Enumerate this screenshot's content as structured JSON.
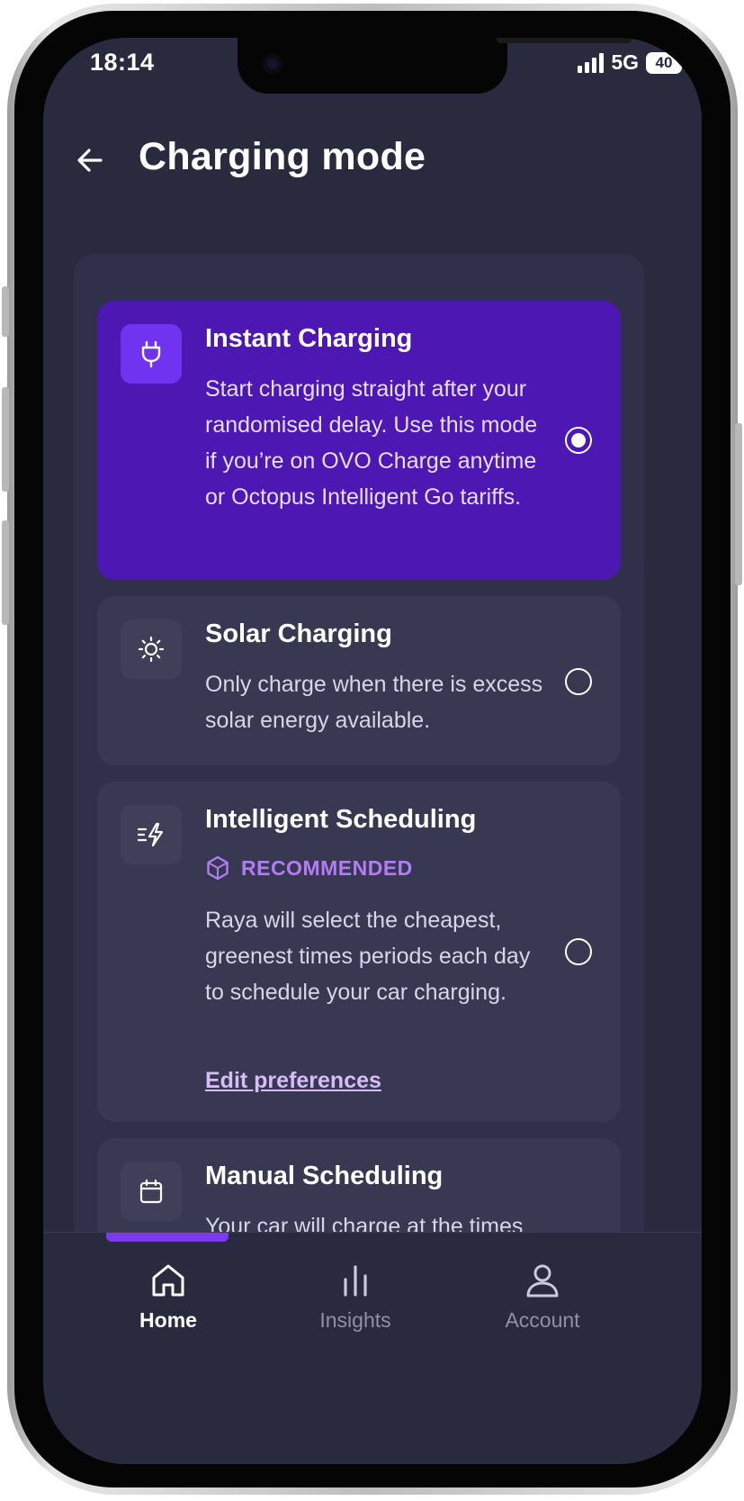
{
  "status_bar": {
    "time": "18:14",
    "network": "5G",
    "battery": "40"
  },
  "header": {
    "title": "Charging mode",
    "back_icon": "arrow-left-icon"
  },
  "modes": [
    {
      "title": "Instant Charging",
      "description": "Start charging straight after your randomised delay. Use this mode if you’re on OVO Charge anytime or Octopus Intelligent Go tariffs.",
      "icon": "plug-icon",
      "selected": true
    },
    {
      "title": "Solar Charging",
      "description": "Only charge when there is excess solar energy available.",
      "icon": "sun-icon",
      "selected": false
    },
    {
      "title": "Intelligent Scheduling",
      "badge": "RECOMMENDED",
      "description": "Raya will select the cheapest, greenest times periods each day to schedule your car charging.",
      "link": "Edit preferences",
      "icon": "smart-lightning-icon",
      "selected": false
    },
    {
      "title": "Manual Scheduling",
      "description": "Your car will charge at the times that you have manually",
      "icon": "calendar-icon",
      "selected": false
    }
  ],
  "tabs": [
    {
      "label": "Home",
      "icon": "home-icon",
      "active": true
    },
    {
      "label": "Insights",
      "icon": "bar-chart-icon",
      "active": false
    },
    {
      "label": "Account",
      "icon": "user-icon",
      "active": false
    }
  ],
  "colors": {
    "background": "#2a2a3f",
    "selected_card": "#4c17b3",
    "accent": "#7c3aed",
    "badge": "#b27df4"
  }
}
